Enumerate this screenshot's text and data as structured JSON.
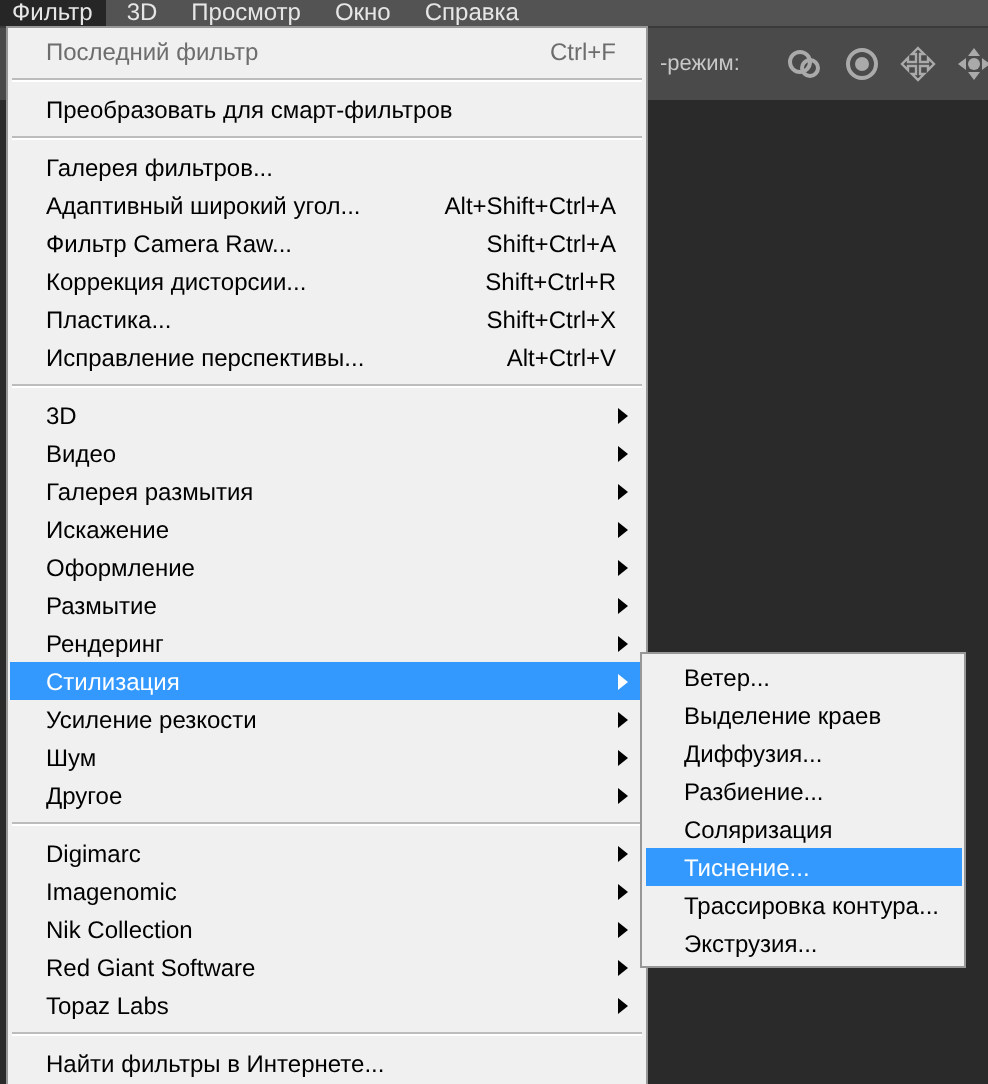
{
  "menubar": [
    {
      "label": "Фильтр",
      "selected": true
    },
    {
      "label": "3D",
      "selected": false
    },
    {
      "label": "Просмотр",
      "selected": false
    },
    {
      "label": "Окно",
      "selected": false
    },
    {
      "label": "Справка",
      "selected": false
    }
  ],
  "toolbar": {
    "label": "-режим:"
  },
  "menu": {
    "groups": [
      [
        {
          "label": "Последний фильтр",
          "shortcut": "Ctrl+F",
          "disabled": true,
          "submenu": false,
          "selected": false
        }
      ],
      [
        {
          "label": "Преобразовать для смарт-фильтров",
          "disabled": false,
          "submenu": false,
          "selected": false
        }
      ],
      [
        {
          "label": "Галерея фильтров...",
          "disabled": false,
          "submenu": false,
          "selected": false
        },
        {
          "label": "Адаптивный широкий угол...",
          "shortcut": "Alt+Shift+Ctrl+A",
          "disabled": false,
          "submenu": false,
          "selected": false
        },
        {
          "label": "Фильтр Camera Raw...",
          "shortcut": "Shift+Ctrl+A",
          "disabled": false,
          "submenu": false,
          "selected": false
        },
        {
          "label": "Коррекция дисторсии...",
          "shortcut": "Shift+Ctrl+R",
          "disabled": false,
          "submenu": false,
          "selected": false
        },
        {
          "label": "Пластика...",
          "shortcut": "Shift+Ctrl+X",
          "disabled": false,
          "submenu": false,
          "selected": false
        },
        {
          "label": "Исправление перспективы...",
          "shortcut": "Alt+Ctrl+V",
          "disabled": false,
          "submenu": false,
          "selected": false
        }
      ],
      [
        {
          "label": "3D",
          "disabled": false,
          "submenu": true,
          "selected": false
        },
        {
          "label": "Видео",
          "disabled": false,
          "submenu": true,
          "selected": false
        },
        {
          "label": "Галерея размытия",
          "disabled": false,
          "submenu": true,
          "selected": false
        },
        {
          "label": "Искажение",
          "disabled": false,
          "submenu": true,
          "selected": false
        },
        {
          "label": "Оформление",
          "disabled": false,
          "submenu": true,
          "selected": false
        },
        {
          "label": "Размытие",
          "disabled": false,
          "submenu": true,
          "selected": false
        },
        {
          "label": "Рендеринг",
          "disabled": false,
          "submenu": true,
          "selected": false
        },
        {
          "label": "Стилизация",
          "disabled": false,
          "submenu": true,
          "selected": true
        },
        {
          "label": "Усиление резкости",
          "disabled": false,
          "submenu": true,
          "selected": false
        },
        {
          "label": "Шум",
          "disabled": false,
          "submenu": true,
          "selected": false
        },
        {
          "label": "Другое",
          "disabled": false,
          "submenu": true,
          "selected": false
        }
      ],
      [
        {
          "label": "Digimarc",
          "disabled": false,
          "submenu": true,
          "selected": false
        },
        {
          "label": "Imagenomic",
          "disabled": false,
          "submenu": true,
          "selected": false
        },
        {
          "label": "Nik Collection",
          "disabled": false,
          "submenu": true,
          "selected": false
        },
        {
          "label": "Red Giant Software",
          "disabled": false,
          "submenu": true,
          "selected": false
        },
        {
          "label": "Topaz Labs",
          "disabled": false,
          "submenu": true,
          "selected": false
        }
      ],
      [
        {
          "label": "Найти фильтры в Интернете...",
          "disabled": false,
          "submenu": false,
          "selected": false
        }
      ]
    ]
  },
  "submenu": {
    "items": [
      {
        "label": "Ветер...",
        "selected": false
      },
      {
        "label": "Выделение краев",
        "selected": false
      },
      {
        "label": "Диффузия...",
        "selected": false
      },
      {
        "label": "Разбиение...",
        "selected": false
      },
      {
        "label": "Соляризация",
        "selected": false
      },
      {
        "label": "Тиснение...",
        "selected": true
      },
      {
        "label": "Трассировка контура...",
        "selected": false
      },
      {
        "label": "Экструзия...",
        "selected": false
      }
    ]
  }
}
